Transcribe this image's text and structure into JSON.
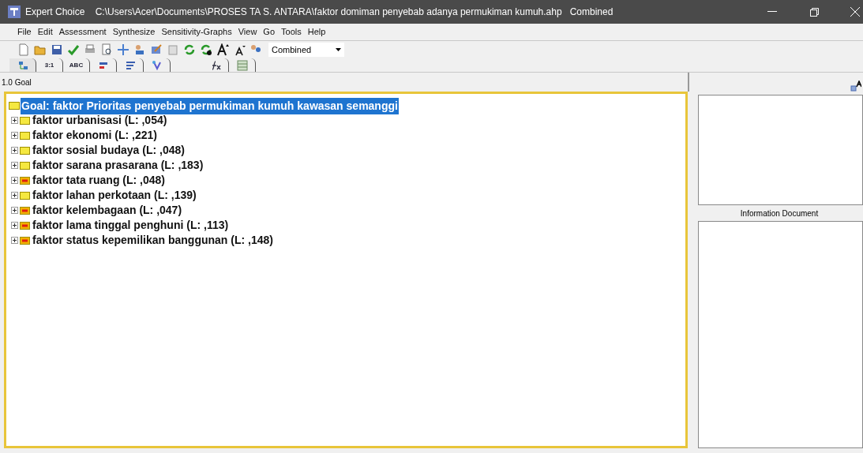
{
  "window": {
    "title": "Expert Choice    C:\\Users\\Acer\\Documents\\PROSES TA S. ANTARA\\faktor domiman penyebab adanya permukiman kumuh.ahp   Combined"
  },
  "menu": [
    "File",
    "Edit",
    "Assessment",
    "Synthesize",
    "Sensitivity-Graphs",
    "View",
    "Go",
    "Tools",
    "Help"
  ],
  "toolbar": {
    "mode_dropdown": "Combined"
  },
  "tabs": [
    {
      "kind": "icon",
      "selected": true
    },
    {
      "kind": "text",
      "label": "3:1",
      "selected": false
    },
    {
      "kind": "text",
      "label": "ABC",
      "selected": false
    },
    {
      "kind": "icon",
      "selected": false
    },
    {
      "kind": "icon",
      "selected": false
    },
    {
      "kind": "icon",
      "selected": false
    },
    {
      "kind": "icon",
      "selected": false
    },
    {
      "kind": "icon",
      "selected": false
    }
  ],
  "path": "1.0 Goal",
  "tree": {
    "goal": {
      "label": "Goal: faktor Prioritas penyebab permukiman kumuh kawasan semanggi",
      "selected": true
    },
    "children": [
      {
        "label": "faktor urbanisasi (L: ,054)",
        "flagged": false
      },
      {
        "label": "faktor ekonomi (L: ,221)",
        "flagged": false
      },
      {
        "label": "faktor sosial budaya (L: ,048)",
        "flagged": false
      },
      {
        "label": "faktor sarana prasarana (L: ,183)",
        "flagged": false
      },
      {
        "label": "faktor tata ruang (L: ,048)",
        "flagged": true
      },
      {
        "label": "faktor lahan perkotaan (L: ,139)",
        "flagged": false
      },
      {
        "label": "faktor kelembagaan (L: ,047)",
        "flagged": true
      },
      {
        "label": "faktor lama tinggal penghuni (L: ,113)",
        "flagged": true
      },
      {
        "label": "faktor status kepemilikan banggunan (L: ,148)",
        "flagged": true
      }
    ]
  },
  "info_panel": {
    "title": "Information Document"
  }
}
